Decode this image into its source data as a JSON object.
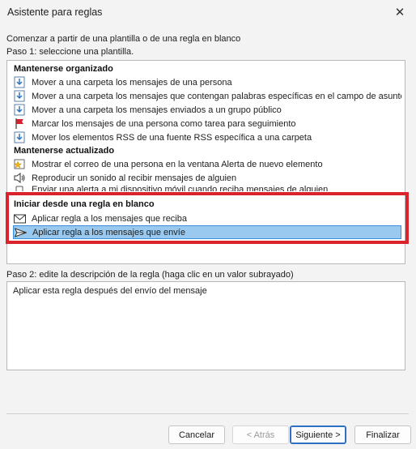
{
  "window": {
    "title": "Asistente para reglas"
  },
  "intro_text": "Comenzar a partir de una plantilla o de una regla en blanco",
  "step1_label": "Paso 1: seleccione una plantilla.",
  "sections": {
    "organized": {
      "heading": "Mantenerse organizado",
      "items": [
        {
          "label": "Mover a una carpeta los mensajes de una persona",
          "icon": "move-to-folder-icon"
        },
        {
          "label": "Mover a una carpeta los mensajes que contengan palabras específicas en el campo de asunto",
          "icon": "move-to-folder-icon"
        },
        {
          "label": "Mover a una carpeta los mensajes enviados a un grupo público",
          "icon": "move-to-folder-icon"
        },
        {
          "label": "Marcar los mensajes de una persona como tarea para seguimiento",
          "icon": "red-flag-icon"
        },
        {
          "label": "Mover los elementos RSS de una fuente RSS específica a una carpeta",
          "icon": "move-to-folder-icon"
        }
      ]
    },
    "updated": {
      "heading": "Mantenerse actualizado",
      "items": [
        {
          "label": "Mostrar el correo de una persona en la ventana Alerta de nuevo elemento",
          "icon": "new-item-alert-icon"
        },
        {
          "label": "Reproducir un sonido al recibir mensajes de alguien",
          "icon": "speaker-icon"
        },
        {
          "label": "Enviar una alerta a mi dispositivo móvil cuando reciba mensajes de alguien",
          "icon": "mobile-alert-icon"
        }
      ]
    },
    "blank": {
      "heading": "Iniciar desde una regla en blanco",
      "items": [
        {
          "label": "Aplicar regla a los mensajes que reciba",
          "icon": "envelope-icon"
        },
        {
          "label": "Aplicar regla a los mensajes que envíe",
          "icon": "send-arrow-icon"
        }
      ]
    }
  },
  "selected_item": "Aplicar regla a los mensajes que envíe",
  "step2_label": "Paso 2: edite la descripción de la regla (haga clic en un valor subrayado)",
  "description_text": "Aplicar esta regla después del envío del mensaje",
  "buttons": {
    "cancel": "Cancelar",
    "back": "< Atrás",
    "next": "Siguiente >",
    "finish": "Finalizar"
  },
  "colors": {
    "selection": "#99c9ef",
    "highlight_frame": "#d9242e"
  }
}
